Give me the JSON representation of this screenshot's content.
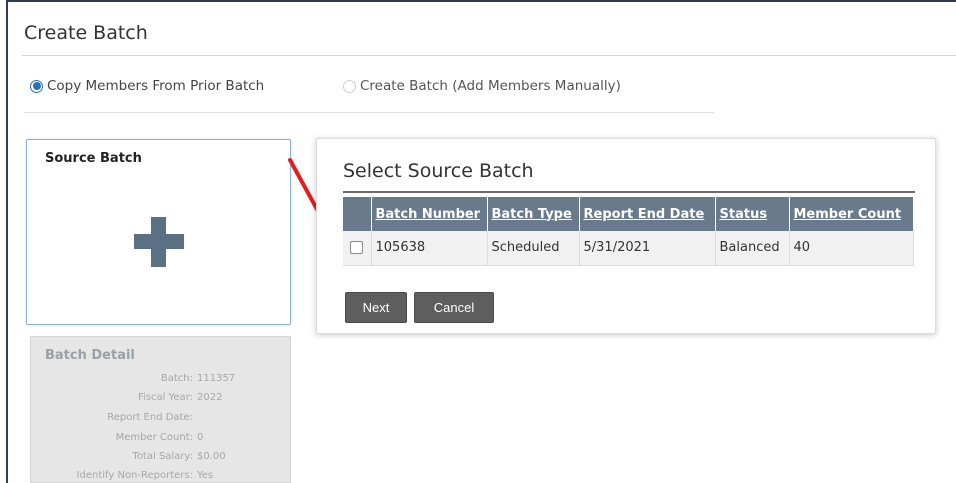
{
  "page": {
    "title": "Create Batch"
  },
  "options": {
    "copy_label": "Copy Members From Prior Batch",
    "manual_label": "Create Batch (Add Members Manually)"
  },
  "source_card": {
    "label": "Source Batch",
    "icon": "plus-icon"
  },
  "batch_detail": {
    "title": "Batch Detail",
    "rows": [
      {
        "key": "Batch:",
        "value": "111357"
      },
      {
        "key": "Fiscal Year:",
        "value": "2022"
      },
      {
        "key": "Report End Date:",
        "value": ""
      },
      {
        "key": "Member Count:",
        "value": "0"
      },
      {
        "key": "Total Salary:",
        "value": "$0.00"
      },
      {
        "key": "Identify Non-Reporters:",
        "value": "Yes"
      }
    ]
  },
  "select_panel": {
    "title": "Select Source Batch",
    "columns": [
      "Batch Number",
      "Batch Type",
      "Report End Date",
      "Status",
      "Member Count"
    ],
    "rows": [
      {
        "batch_number": "105638",
        "batch_type": "Scheduled",
        "report_end_date": "5/31/2021",
        "status": "Balanced",
        "member_count": "40"
      }
    ],
    "next_label": "Next",
    "cancel_label": "Cancel"
  },
  "colors": {
    "accent": "#2a6ebb",
    "header_bg": "#6a7a8d",
    "button_bg": "#5e5e5e",
    "arrow": "#e02020"
  }
}
